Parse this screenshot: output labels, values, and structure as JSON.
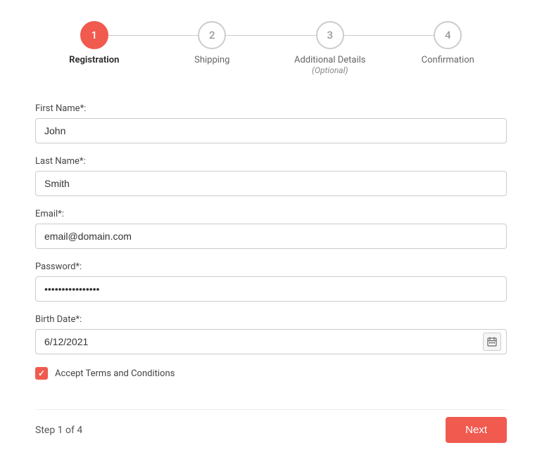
{
  "stepper": {
    "steps": [
      {
        "number": "1",
        "label": "Registration",
        "sublabel": "",
        "active": true
      },
      {
        "number": "2",
        "label": "Shipping",
        "sublabel": "",
        "active": false
      },
      {
        "number": "3",
        "label": "Additional Details",
        "sublabel": "(Optional)",
        "active": false
      },
      {
        "number": "4",
        "label": "Confirmation",
        "sublabel": "",
        "active": false
      }
    ]
  },
  "form": {
    "first_name_label": "First Name*:",
    "first_name_value": "John",
    "last_name_label": "Last Name*:",
    "last_name_value": "Smith",
    "email_label": "Email*:",
    "email_value": "email@domain.com",
    "password_label": "Password*:",
    "password_value": "••••••••••••••••••",
    "birth_date_label": "Birth Date*:",
    "birth_date_value": "6/12/2021",
    "terms_label": "Accept Terms and Conditions"
  },
  "footer": {
    "step_counter": "Step 1 of 4",
    "next_label": "Next"
  },
  "colors": {
    "accent": "#f05a4f"
  }
}
